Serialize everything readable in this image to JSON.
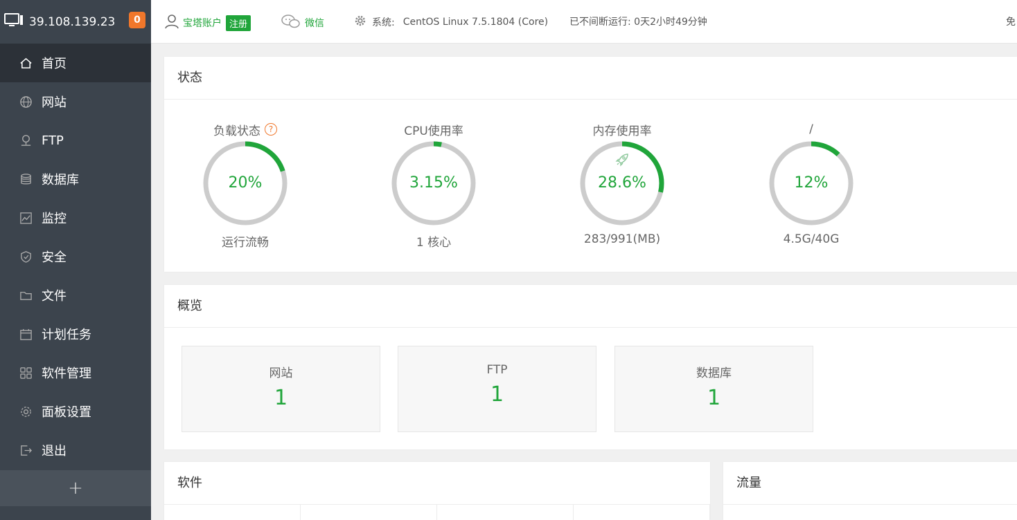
{
  "sidebar": {
    "ip": "39.108.139.23",
    "badge": "0",
    "items": [
      {
        "label": "首页",
        "icon": "home-icon"
      },
      {
        "label": "网站",
        "icon": "globe-icon"
      },
      {
        "label": "FTP",
        "icon": "ftp-icon"
      },
      {
        "label": "数据库",
        "icon": "database-icon"
      },
      {
        "label": "监控",
        "icon": "monitor-icon"
      },
      {
        "label": "安全",
        "icon": "shield-icon"
      },
      {
        "label": "文件",
        "icon": "folder-icon"
      },
      {
        "label": "计划任务",
        "icon": "calendar-icon"
      },
      {
        "label": "软件管理",
        "icon": "grid-icon"
      },
      {
        "label": "面板设置",
        "icon": "gear-icon"
      },
      {
        "label": "退出",
        "icon": "logout-icon"
      }
    ],
    "add": "+"
  },
  "header": {
    "account": "宝塔账户",
    "register": "注册",
    "wechat": "微信",
    "system_label": "系统:",
    "system_value": "CentOS Linux 7.5.1804 (Core)",
    "uptime": "已不间断运行: 0天2小时49分钟",
    "free": "免"
  },
  "status": {
    "title": "状态",
    "gauges": [
      {
        "title": "负载状态",
        "value": "20%",
        "sub": "运行流畅",
        "fraction": 0.2
      },
      {
        "title": "CPU使用率",
        "value": "3.15%",
        "sub": "1 核心",
        "fraction": 0.0315
      },
      {
        "title": "内存使用率",
        "value": "28.6%",
        "sub": "283/991(MB)",
        "fraction": 0.286
      },
      {
        "title": "/",
        "value": "12%",
        "sub": "4.5G/40G",
        "fraction": 0.12
      }
    ]
  },
  "overview": {
    "title": "概览",
    "boxes": [
      {
        "label": "网站",
        "value": "1"
      },
      {
        "label": "FTP",
        "value": "1"
      },
      {
        "label": "数据库",
        "value": "1"
      }
    ]
  },
  "software": {
    "title": "软件"
  },
  "traffic": {
    "title": "流量"
  },
  "colors": {
    "accent": "#20a53a",
    "sidebar": "#3c444d",
    "badge": "#f0772b",
    "ring_bg": "#cccccc"
  }
}
